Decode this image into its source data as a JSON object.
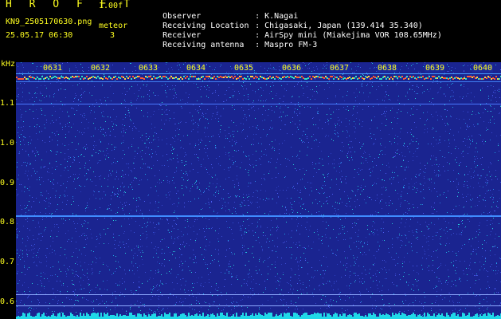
{
  "header": {
    "title": "H R O F F T",
    "version": "1.00f",
    "filename": "KN9_2505170630.png",
    "meteor_label": "meteor",
    "timestamp": "25.05.17 06:30",
    "meteor_count": "3"
  },
  "info": [
    {
      "label": "Observer",
      "value": "K.Nagai"
    },
    {
      "label": "Receiving Location",
      "value": "Chigasaki, Japan (139.414 35.340)"
    },
    {
      "label": "Receiver",
      "value": "AirSpy mini (Miakejima VOR 108.65MHz)"
    },
    {
      "label": "Receiving antenna",
      "value": "Maspro FM-3"
    }
  ],
  "axis": {
    "y_unit": "kHz",
    "y_ticks": [
      "1.1",
      "1.0",
      "0.9",
      "0.8",
      "0.7",
      "0.6"
    ],
    "x_ticks": [
      "0631",
      "0632",
      "0633",
      "0634",
      "0635",
      "0636",
      "0637",
      "0638",
      "0639",
      "0640"
    ]
  },
  "colors": {
    "background": "#1a2490",
    "label": "#ffff20",
    "text": "#ffffff"
  }
}
